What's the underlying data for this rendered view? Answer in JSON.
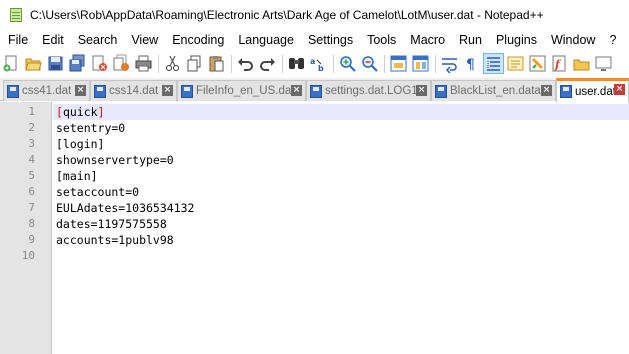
{
  "window": {
    "title": "C:\\Users\\Rob\\AppData\\Roaming\\Electronic Arts\\Dark Age of Camelot\\LotM\\user.dat - Notepad++",
    "app_icon": "notepad-plus-plus-icon"
  },
  "menu": [
    "File",
    "Edit",
    "Search",
    "View",
    "Encoding",
    "Language",
    "Settings",
    "Tools",
    "Macro",
    "Run",
    "Plugins",
    "Window",
    "?"
  ],
  "toolbar": {
    "icons": [
      "new-file-icon",
      "open-file-icon",
      "save-icon",
      "save-all-icon",
      "close-icon",
      "close-all-icon",
      "print-icon",
      "cut-icon",
      "copy-icon",
      "paste-icon",
      "undo-icon",
      "redo-icon",
      "find-icon",
      "replace-icon",
      "zoom-in-icon",
      "zoom-out-icon",
      "sync-vertical-icon",
      "sync-horizontal-icon",
      "word-wrap-icon",
      "show-all-chars-icon",
      "indent-guide-icon",
      "doc-map-icon",
      "function-list-icon",
      "folder-workspace-icon",
      "monitor-icon"
    ]
  },
  "tabs": [
    {
      "label": "css41.dat",
      "active": false
    },
    {
      "label": "css14.dat",
      "active": false
    },
    {
      "label": "FileInfo_en_US.dat",
      "active": false
    },
    {
      "label": "settings.dat.LOG1",
      "active": false
    },
    {
      "label": "BlackList_en.data",
      "active": false
    },
    {
      "label": "user.dat",
      "active": true
    }
  ],
  "editor": {
    "line_numbers": [
      "1",
      "2",
      "3",
      "4",
      "5",
      "6",
      "7",
      "8",
      "9",
      "10"
    ],
    "lines": [
      "[quick]",
      "setentry=0",
      "[login]",
      "shownservertype=0",
      "[main]",
      "setaccount=0",
      "EULAdates=1036534132",
      "dates=1197575558",
      "accounts=1publv98",
      ""
    ],
    "line1_parts": {
      "open": "[",
      "word": "quick",
      "close": "]"
    }
  },
  "colors": {
    "active_tab_accent": "#fa8728",
    "current_line": "#e8e8ff",
    "brace_match": "#ff0000",
    "gutter": "#e4e4e4"
  }
}
